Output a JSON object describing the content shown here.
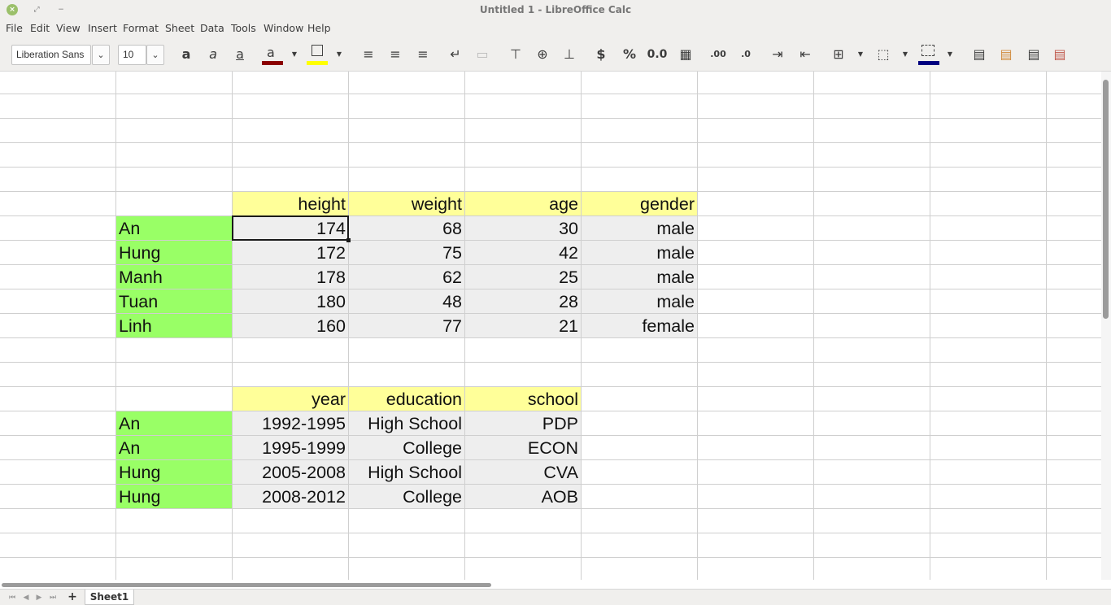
{
  "window": {
    "title": "Untitled 1 - LibreOffice Calc"
  },
  "menu": [
    "File",
    "Edit",
    "View",
    "Insert",
    "Format",
    "Sheet",
    "Data",
    "Tools",
    "Window",
    "Help"
  ],
  "toolbar": {
    "font_name": "Liberation Sans",
    "font_size": "10",
    "font_color": "#8b0000",
    "highlight_color": "#ffff00",
    "border_color": "#000080",
    "currency_label": "$",
    "percent_label": "%",
    "number_label": "0.0"
  },
  "table1": {
    "headers": [
      "height",
      "weight",
      "age",
      "gender"
    ],
    "rows": [
      {
        "name": "An",
        "values": [
          "174",
          "68",
          "30",
          "male"
        ]
      },
      {
        "name": "Hung",
        "values": [
          "172",
          "75",
          "42",
          "male"
        ]
      },
      {
        "name": "Manh",
        "values": [
          "178",
          "62",
          "25",
          "male"
        ]
      },
      {
        "name": "Tuan",
        "values": [
          "180",
          "48",
          "28",
          "male"
        ]
      },
      {
        "name": "Linh",
        "values": [
          "160",
          "77",
          "21",
          "female"
        ]
      }
    ]
  },
  "table2": {
    "headers": [
      "year",
      "education",
      "school"
    ],
    "rows": [
      {
        "name": "An",
        "values": [
          "1992-1995",
          "High School",
          "PDP"
        ]
      },
      {
        "name": "An",
        "values": [
          "1995-1999",
          "College",
          "ECON"
        ]
      },
      {
        "name": "Hung",
        "values": [
          "2005-2008",
          "High School",
          "CVA"
        ]
      },
      {
        "name": "Hung",
        "values": [
          "2008-2012",
          "College",
          "AOB"
        ]
      }
    ]
  },
  "sheet_tabs": [
    "Sheet1"
  ],
  "colors": {
    "header_fill": "#ffff99",
    "name_fill": "#99ff66",
    "value_fill": "#eeeeee"
  }
}
